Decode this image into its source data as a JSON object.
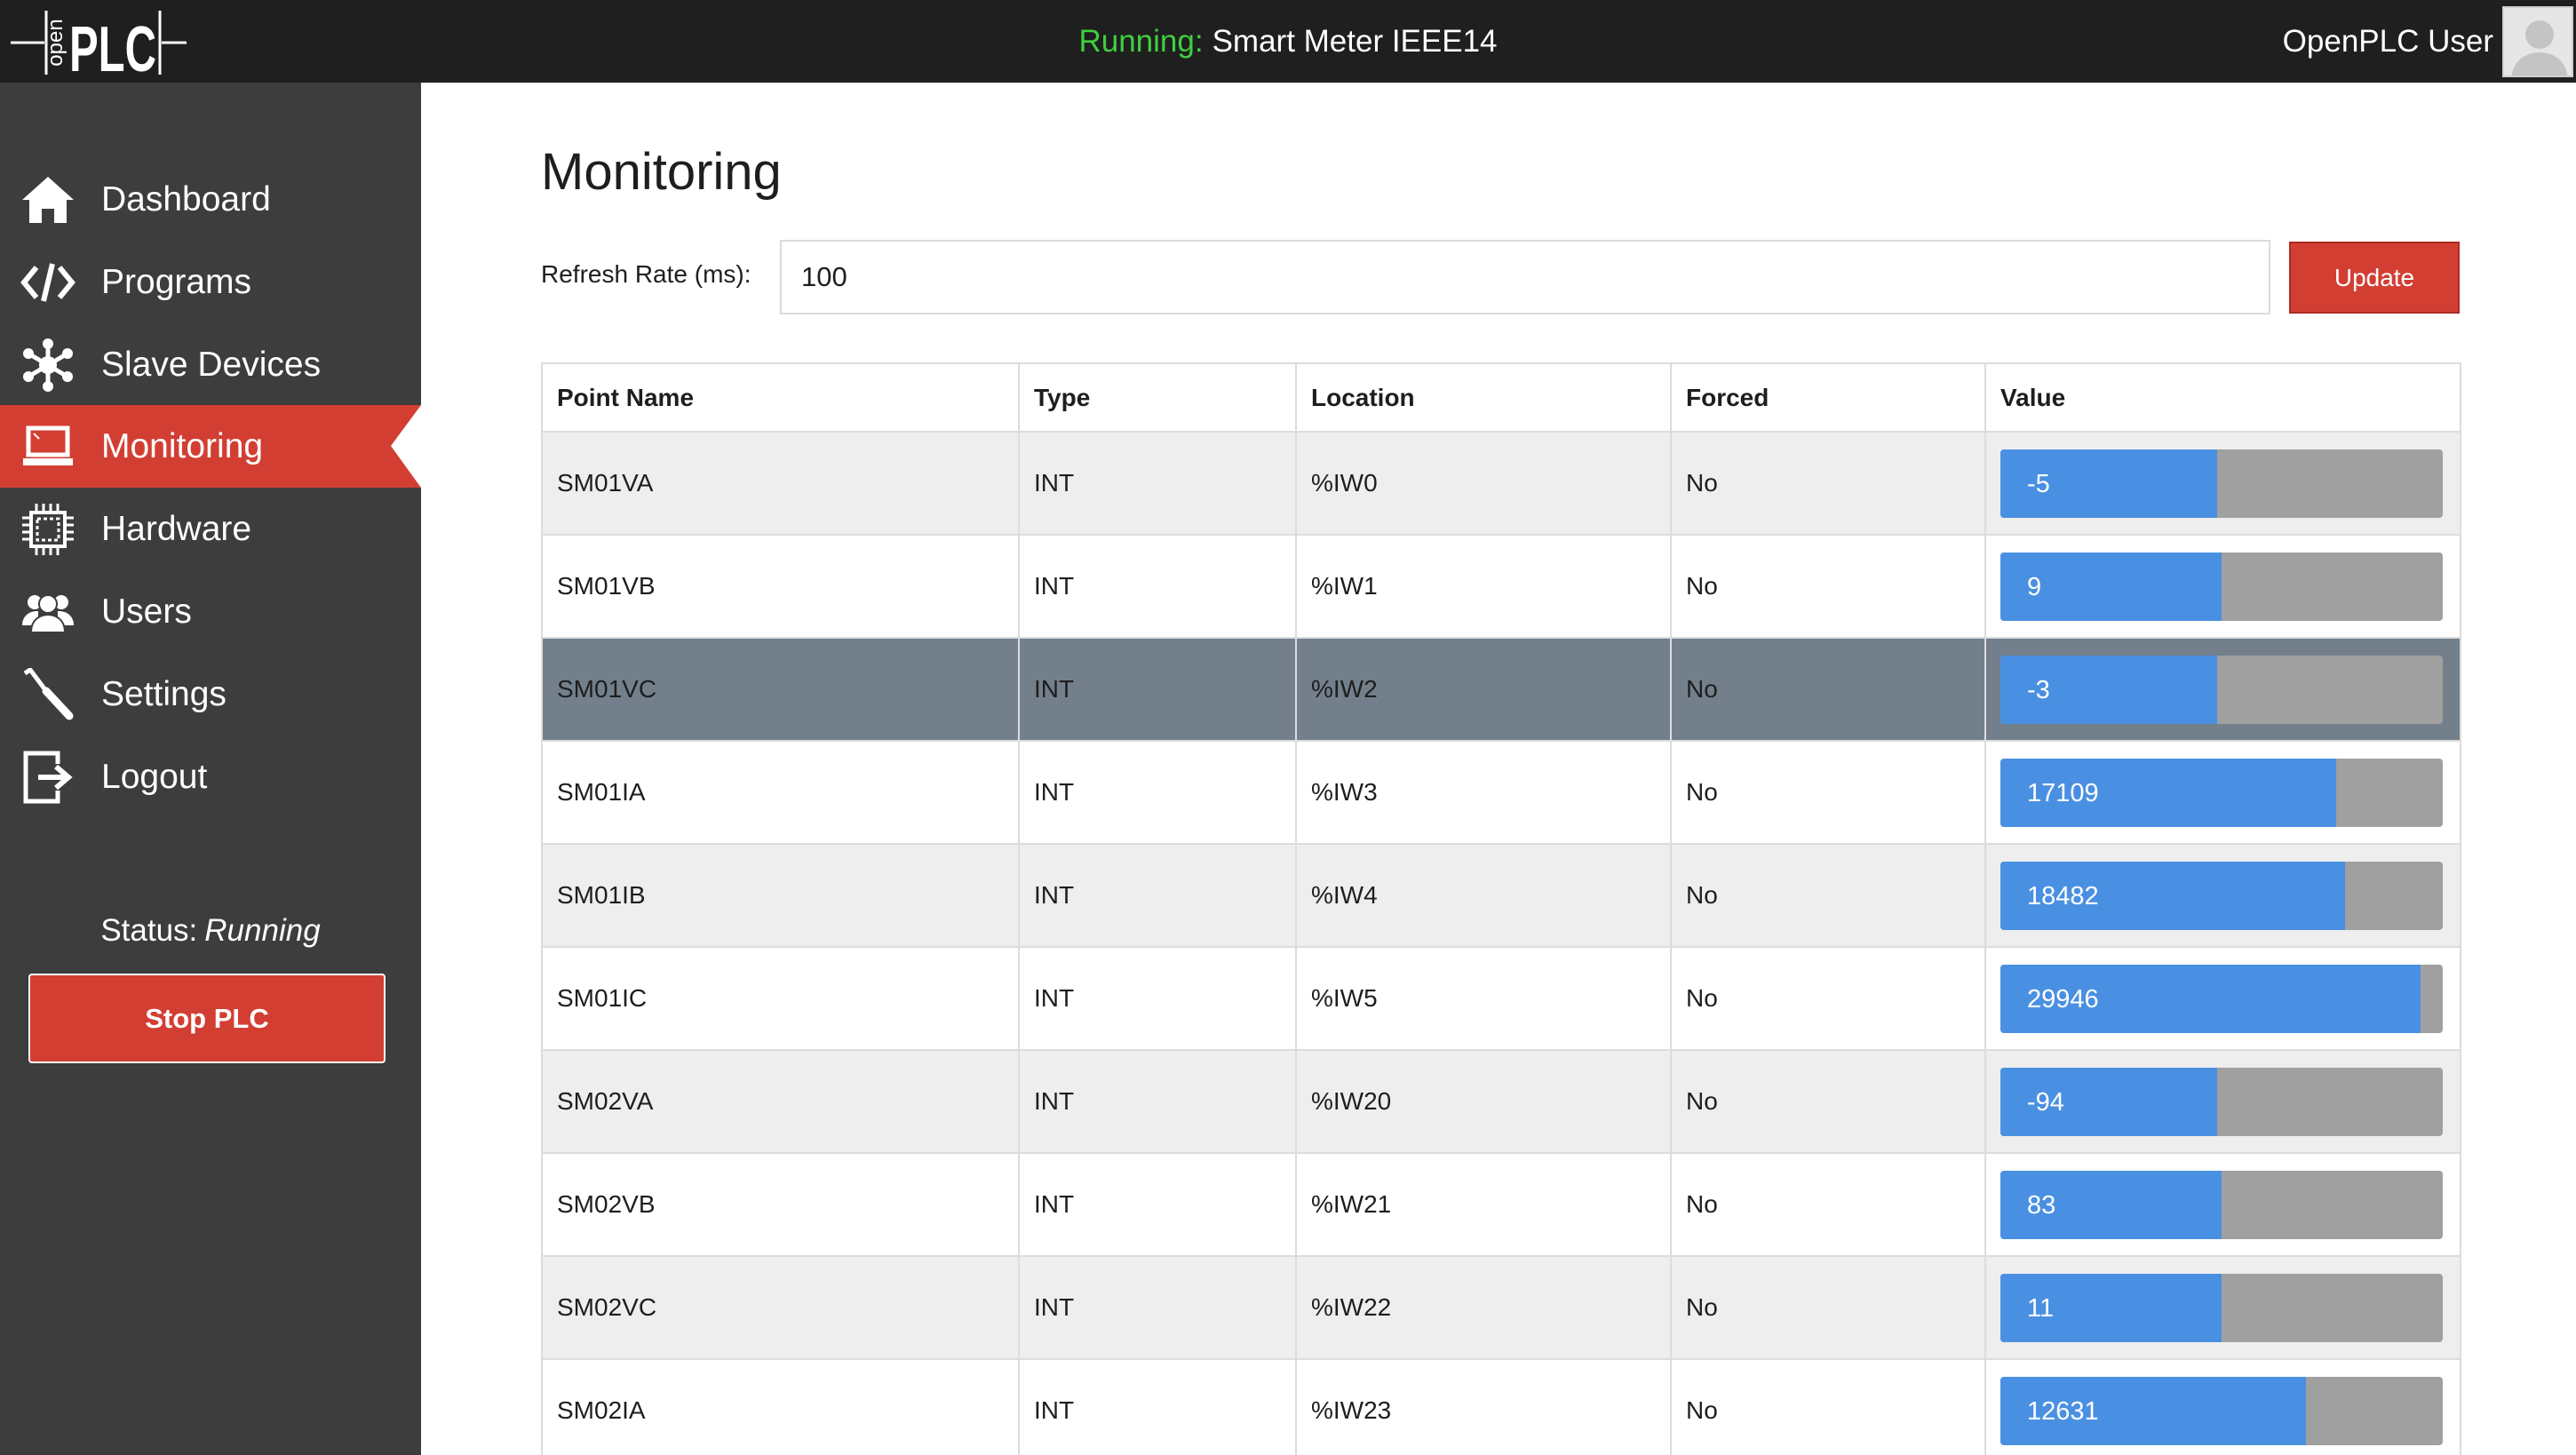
{
  "app": {
    "logo_text": "openPLC",
    "status_label": "Running:",
    "program_name": "Smart Meter IEEE14",
    "user_name": "OpenPLC User"
  },
  "sidebar": {
    "items": [
      {
        "label": "Dashboard",
        "icon": "home-icon",
        "active": false
      },
      {
        "label": "Programs",
        "icon": "code-icon",
        "active": false
      },
      {
        "label": "Slave Devices",
        "icon": "network-icon",
        "active": false
      },
      {
        "label": "Monitoring",
        "icon": "laptop-icon",
        "active": true
      },
      {
        "label": "Hardware",
        "icon": "chip-icon",
        "active": false
      },
      {
        "label": "Users",
        "icon": "users-icon",
        "active": false
      },
      {
        "label": "Settings",
        "icon": "wrench-icon",
        "active": false
      },
      {
        "label": "Logout",
        "icon": "logout-icon",
        "active": false
      }
    ],
    "status_label": "Status:",
    "status_value": "Running",
    "stop_button": "Stop PLC"
  },
  "main": {
    "title": "Monitoring",
    "refresh_label": "Refresh Rate (ms):",
    "refresh_value": "100",
    "update_button": "Update",
    "columns": [
      "Point Name",
      "Type",
      "Location",
      "Forced",
      "Value"
    ],
    "rows": [
      {
        "name": "SM01VA",
        "type": "INT",
        "location": "%IW0",
        "forced": "No",
        "value": "-5",
        "fill": 0.49,
        "selected": false
      },
      {
        "name": "SM01VB",
        "type": "INT",
        "location": "%IW1",
        "forced": "No",
        "value": "9",
        "fill": 0.5,
        "selected": false
      },
      {
        "name": "SM01VC",
        "type": "INT",
        "location": "%IW2",
        "forced": "No",
        "value": "-3",
        "fill": 0.49,
        "selected": true
      },
      {
        "name": "SM01IA",
        "type": "INT",
        "location": "%IW3",
        "forced": "No",
        "value": "17109",
        "fill": 0.76,
        "selected": false
      },
      {
        "name": "SM01IB",
        "type": "INT",
        "location": "%IW4",
        "forced": "No",
        "value": "18482",
        "fill": 0.78,
        "selected": false
      },
      {
        "name": "SM01IC",
        "type": "INT",
        "location": "%IW5",
        "forced": "No",
        "value": "29946",
        "fill": 0.95,
        "selected": false
      },
      {
        "name": "SM02VA",
        "type": "INT",
        "location": "%IW20",
        "forced": "No",
        "value": "-94",
        "fill": 0.49,
        "selected": false
      },
      {
        "name": "SM02VB",
        "type": "INT",
        "location": "%IW21",
        "forced": "No",
        "value": "83",
        "fill": 0.5,
        "selected": false
      },
      {
        "name": "SM02VC",
        "type": "INT",
        "location": "%IW22",
        "forced": "No",
        "value": "11",
        "fill": 0.5,
        "selected": false
      },
      {
        "name": "SM02IA",
        "type": "INT",
        "location": "%IW23",
        "forced": "No",
        "value": "12631",
        "fill": 0.69,
        "selected": false
      }
    ]
  },
  "colors": {
    "topbar": "#1f1f1f",
    "sidebar": "#3d3d3d",
    "accent_red": "#d33e33",
    "running_green": "#3fcf3f",
    "bar_blue": "#4a90e2",
    "bar_gray": "#a0a0a0",
    "selected_row": "#73808c"
  }
}
